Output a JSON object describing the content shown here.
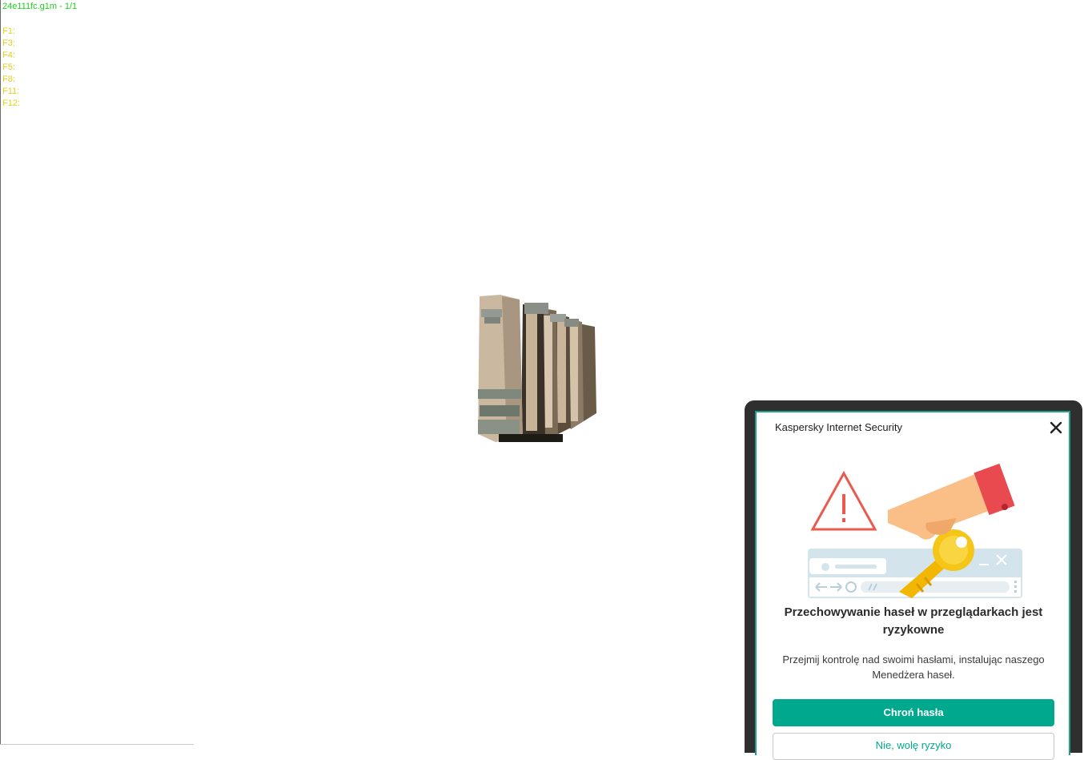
{
  "hud": {
    "title": "24e111fc.g1m - 1/1",
    "fkeys": [
      "F1:",
      "F3:",
      "F4:",
      "F5:",
      "F8:",
      "F11:",
      "F12:"
    ],
    "title_color": "#19d419",
    "fkeys_color": "#e2d21a"
  },
  "viewport": {
    "model": "stone-wall-model"
  },
  "popup": {
    "app_name": "Kaspersky Internet Security",
    "headline": "Przechowywanie haseł w przeglądarkach jest ryzykowne",
    "body": "Przejmij kontrolę nad swoimi hasłami, instalując naszego Menedżera haseł.",
    "primary_button": "Chroń hasła",
    "secondary_button": "Nie, wolę ryzyko",
    "accent_color": "#00a88e",
    "illustration": "warning-key-browser-illustration"
  }
}
